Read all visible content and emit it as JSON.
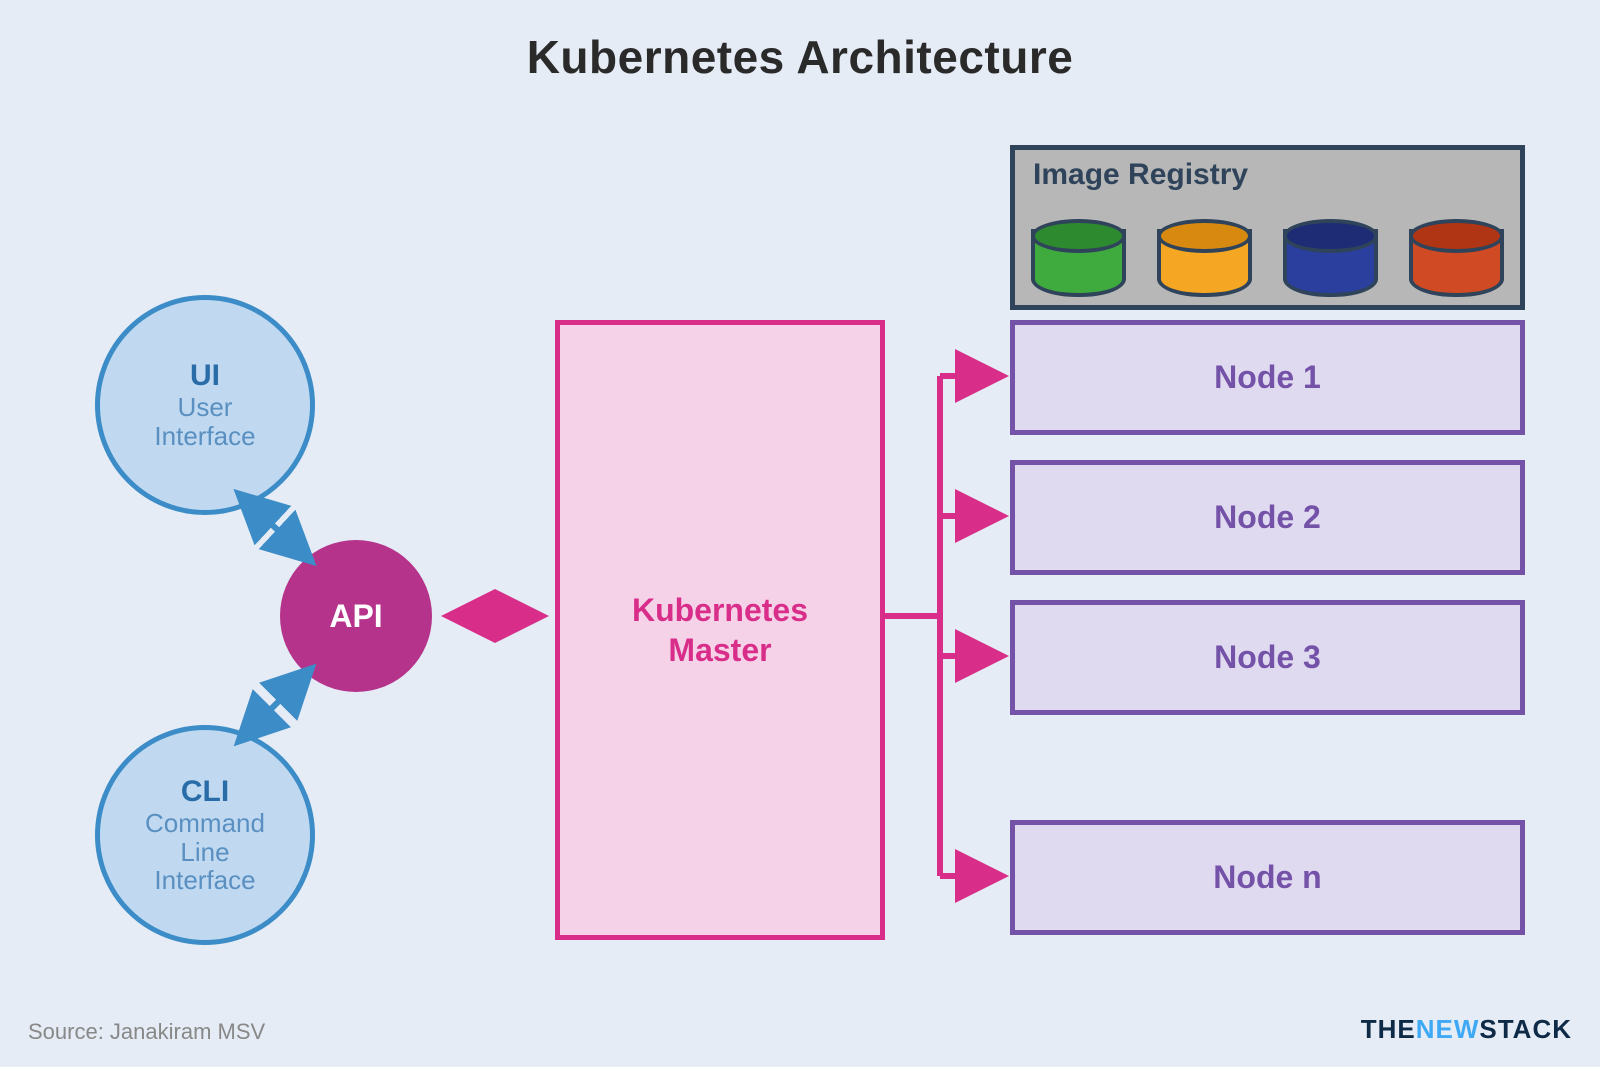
{
  "title": "Kubernetes Architecture",
  "ui": {
    "head": "UI",
    "sub1": "User",
    "sub2": "Interface"
  },
  "cli": {
    "head": "CLI",
    "sub1": "Command",
    "sub2": "Line",
    "sub3": "Interface"
  },
  "api": {
    "label": "API"
  },
  "master": {
    "line1": "Kubernetes",
    "line2": "Master"
  },
  "registry": {
    "label": "Image Registry",
    "colors": [
      {
        "body": "#3fab3f",
        "top": "#2e8a2e"
      },
      {
        "body": "#f5a623",
        "top": "#d88a10"
      },
      {
        "body": "#2a3f9e",
        "top": "#1e2c75"
      },
      {
        "body": "#d04a24",
        "top": "#b03514"
      }
    ]
  },
  "nodes": [
    "Node 1",
    "Node 2",
    "Node 3",
    "Node n"
  ],
  "source": "Source: Janakiram MSV",
  "brand": {
    "p1": "THE",
    "p2": "NEW",
    "p3": "STACK"
  },
  "palette": {
    "bg": "#e5ecf5",
    "blue_stroke": "#3c8cc7",
    "blue_fill": "#c0d9f0",
    "magenta": "#d82e8a",
    "magenta_fill": "#f5d2e8",
    "api_fill": "#b5338a",
    "purple": "#7352a8",
    "purple_fill": "#e0daf0",
    "dark": "#2f435a",
    "grey": "#b7b7b7"
  }
}
